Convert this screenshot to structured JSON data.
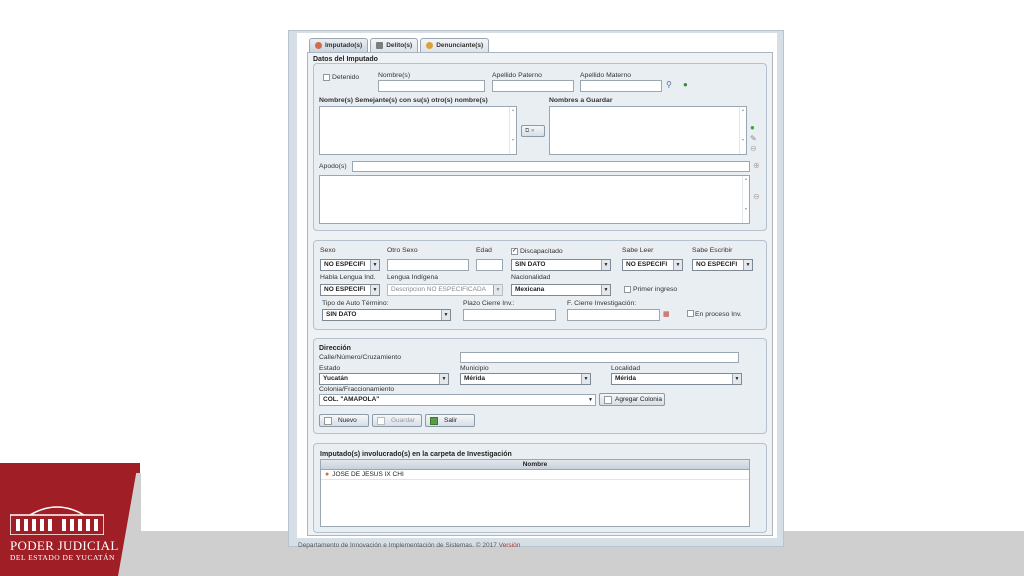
{
  "tabs": [
    {
      "label": "Imputado(s)",
      "icon": "person-icon"
    },
    {
      "label": "Delito(s)",
      "icon": "scale-icon"
    },
    {
      "label": "Denunciante(s)",
      "icon": "person-icon"
    }
  ],
  "datos": {
    "title": "Datos del Imputado",
    "detenido_label": "Detenido",
    "nombres_label": "Nombre(s)",
    "apellido_paterno_label": "Apellido Paterno",
    "apellido_materno_label": "Apellido Materno",
    "semejantes_label": "Nombre(s) Semejante(s) con su(s) otro(s) nombre(s)",
    "guardar_label": "Nombres a Guardar",
    "apodo_label": "Apodo(s)"
  },
  "personal": {
    "sexo_label": "Sexo",
    "sexo_value": "NO ESPECIFI",
    "otro_sexo_label": "Otro Sexo",
    "edad_label": "Edad",
    "discapacitado_label": "Discapacitado",
    "discapacitado_value": "SIN DATO",
    "sabe_leer_label": "Sabe Leer",
    "sabe_leer_value": "NO ESPECIFI",
    "sabe_escribir_label": "Sabe Escribir",
    "sabe_escribir_value": "NO ESPECIFI",
    "habla_lengua_label": "Habla Lengua Ind.",
    "habla_lengua_value": "NO ESPECIFI",
    "lengua_indigena_label": "Lengua Indígena",
    "lengua_indigena_value": "Descripcion NO ESPECIFICADA",
    "nacionalidad_label": "Nacionalidad",
    "nacionalidad_value": "Mexicana",
    "primer_ingreso_label": "Primer ingreso",
    "tipo_auto_label": "Tipo de Auto Término:",
    "tipo_auto_value": "SIN DATO",
    "plazo_label": "Plazo Cierre Inv.:",
    "cierre_label": "F. Cierre Investigación:",
    "en_proceso_label": "En proceso Inv."
  },
  "direccion": {
    "title": "Dirección",
    "calle_label": "Calle/Número/Cruzamiento",
    "estado_label": "Estado",
    "estado_value": "Yucatán",
    "municipio_label": "Municipio",
    "municipio_value": "Mérida",
    "localidad_label": "Localidad",
    "localidad_value": "Mérida",
    "colonia_label": "Colonia/Fraccionamiento",
    "colonia_value": "COL. \"AMAPOLA\"",
    "agregar_colonia_label": "Agregar Colonia"
  },
  "buttons": {
    "nuevo": "Nuevo",
    "guardar": "Guardar",
    "salir": "Salir"
  },
  "involucrados": {
    "title": "Imputado(s) involucrado(s) en la carpeta de Investigación",
    "column": "Nombre",
    "rows": [
      "JOSE DE JESUS IX CHI"
    ]
  },
  "footer": {
    "text": "Departamento de Innovación e Implementación de Sistemas. © 2017",
    "version": "Versión"
  },
  "branding": {
    "line1": "PODER JUDICIAL",
    "line2": "DEL ESTADO DE YUCATÁN",
    "color": "#a01e25"
  }
}
